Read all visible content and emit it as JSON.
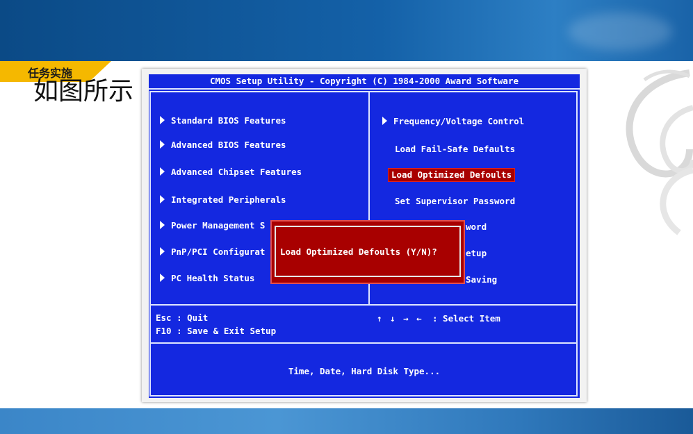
{
  "slide": {
    "tag": "任务实施",
    "subtitle": "如图所示"
  },
  "bios": {
    "title": "CMOS Setup Utility - Copyright (C) 1984-2000 Award Software",
    "left_menu": [
      {
        "label": "Standard BIOS Features",
        "arrow": true
      },
      {
        "label": "Advanced BIOS Features",
        "arrow": true
      },
      {
        "label": "Advanced Chipset Features",
        "arrow": true
      },
      {
        "label": "Integrated Peripherals",
        "arrow": true
      },
      {
        "label": "Power Management S",
        "arrow": true
      },
      {
        "label": "PnP/PCI Configurat",
        "arrow": true
      },
      {
        "label": "PC Health Status",
        "arrow": true
      }
    ],
    "right_menu": [
      {
        "label": "Frequency/Voltage Control",
        "arrow": true
      },
      {
        "label": "Load Fail-Safe Defaults",
        "arrow": false
      },
      {
        "label": "Load Optimized Defoults",
        "arrow": false,
        "selected": true
      },
      {
        "label": "Set Supervisor Password",
        "arrow": false
      },
      {
        "label": "word",
        "arrow": false
      },
      {
        "label": "etup",
        "arrow": false
      },
      {
        "label": "Saving",
        "arrow": false
      }
    ],
    "dialog": {
      "message": "Load Optimized Defoults (Y/N)?"
    },
    "help": {
      "esc": "Esc : Quit",
      "f10": "F10 : Save & Exit Setup",
      "arrows": "↑ ↓ → ←",
      "select": ": Select Item"
    },
    "description": "Time, Date, Hard Disk Type..."
  },
  "colors": {
    "bios_background": "#1428e0",
    "selection": "#a80000",
    "tag": "#f5b800",
    "banner": "#1461a8"
  }
}
